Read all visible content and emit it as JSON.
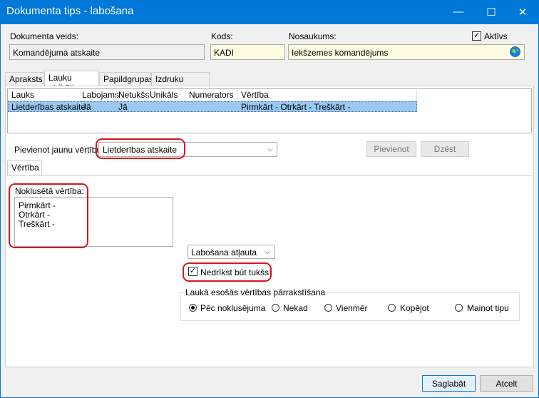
{
  "window": {
    "title": "Dokumenta tips - labošana",
    "minimize_glyph": "—",
    "maximize_glyph": "☐",
    "close_glyph": "✕"
  },
  "header": {
    "doc_type_label": "Dokumenta veids:",
    "doc_type_value": "Komandējuma atskaite",
    "code_label": "Kods:",
    "code_value": "KADI",
    "name_label": "Nosaukums:",
    "name_value": "Iekšzemes komandējums",
    "active_label": "Aktīvs",
    "active_checked": true
  },
  "tabs": [
    "Apraksts",
    "Lauku atribūti",
    "Papildgrupas",
    "Izdruku formas"
  ],
  "active_tab": "Lauku atribūti",
  "grid": {
    "columns": [
      "Lauks",
      "Labojams",
      "Netukšs",
      "Unikāls",
      "Numerators",
      "Vērtība"
    ],
    "rows": [
      {
        "lauks": "Lietderības atskaite",
        "labojams": "Jā",
        "netukss": "Jā",
        "unikals": "",
        "numerators": "",
        "vertiba": "Pirmkārt - Otrkārt - Treškārt -"
      }
    ]
  },
  "add_value": {
    "label": "Pievienot jaunu vērtību:",
    "selected": "Lietderības atskaite",
    "add_button": "Pievienot",
    "delete_button": "Dzēst"
  },
  "value_tab": {
    "label": "Vērtība"
  },
  "default_value": {
    "label": "Noklusētā vērtība:",
    "lines": [
      "Pirmkārt -",
      "Otrkārt -",
      "Treškārt -"
    ]
  },
  "edit_mode": {
    "selected": "Labošana atļauta"
  },
  "not_empty": {
    "label": "Nedrīkst būt tukšs",
    "checked": true
  },
  "overwrite_group": {
    "title": "Laukā esošās vērtības pārrakstīšana",
    "options": [
      "Pēc noklusējuma",
      "Nekad",
      "Vienmēr",
      "Kopējot",
      "Mainot tipu"
    ],
    "selected": "Pēc noklusējuma"
  },
  "footer": {
    "save": "Saglabāt",
    "cancel": "Atcelt"
  },
  "colors": {
    "titlebar": "#0078d7",
    "selection": "#99c9ef",
    "highlight_ring": "#d9161c",
    "mandatory_field": "#fffbe0"
  }
}
